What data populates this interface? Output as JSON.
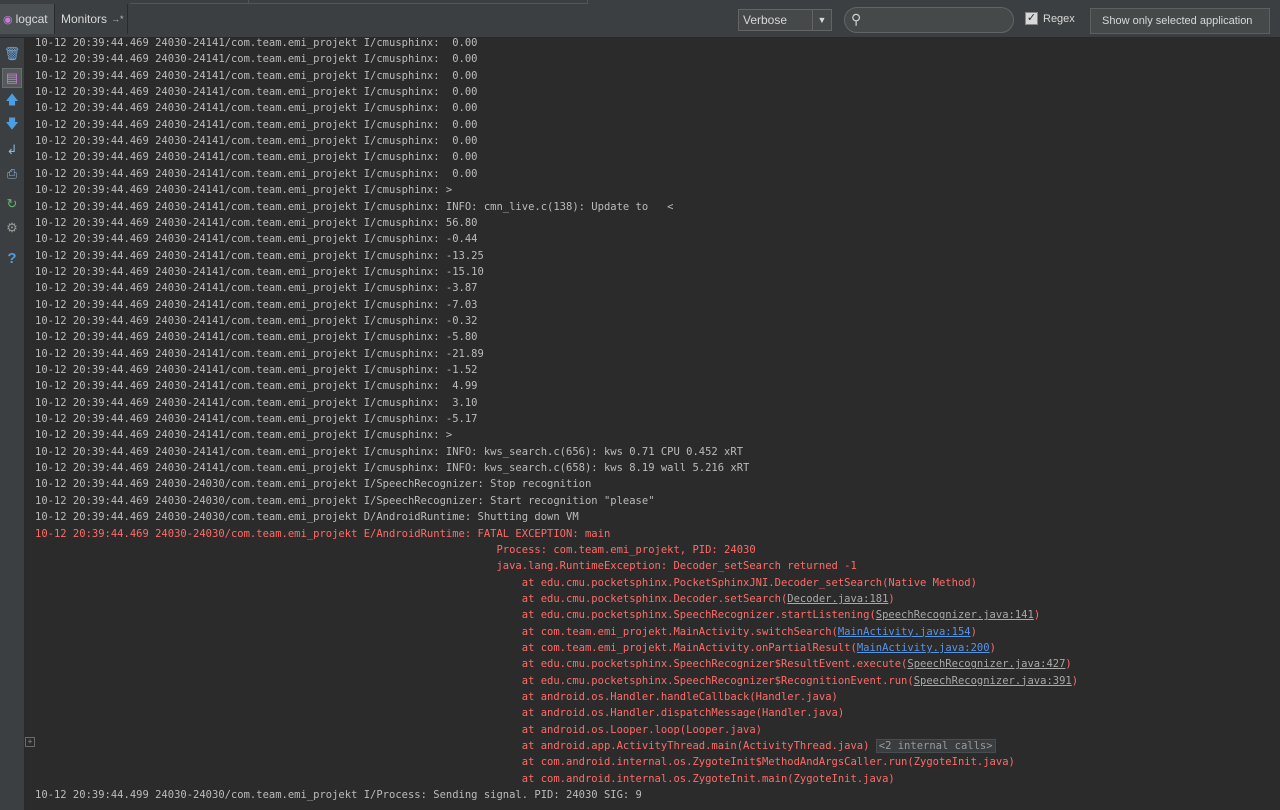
{
  "toolbar": {
    "tab_logcat": "logcat",
    "tab_monitors": "Monitors",
    "monitors_arrow": "→*",
    "log_level": "Verbose",
    "search_value": "",
    "regex_label": "Regex",
    "regex_checked": true,
    "filter_option": "Show only selected application"
  },
  "sidebar": {
    "icons": [
      "trash-icon",
      "scroll-to-end-icon",
      "up-arrow-icon",
      "down-arrow-icon",
      "soft-wrap-icon",
      "print-icon",
      "restart-icon",
      "settings-icon",
      "help-icon"
    ]
  },
  "colors": {
    "info": "#bbbbbb",
    "error": "#ff6b68",
    "link": "#5894e6",
    "background": "#2b2b2b"
  },
  "log": {
    "lines": [
      {
        "text": "10-12 20:39:44.469 24030-24141/com.team.emi_projekt I/cmusphinx:  0.00",
        "err": false
      },
      {
        "text": "10-12 20:39:44.469 24030-24141/com.team.emi_projekt I/cmusphinx:  0.00",
        "err": false
      },
      {
        "text": "10-12 20:39:44.469 24030-24141/com.team.emi_projekt I/cmusphinx:  0.00",
        "err": false
      },
      {
        "text": "10-12 20:39:44.469 24030-24141/com.team.emi_projekt I/cmusphinx:  0.00",
        "err": false
      },
      {
        "text": "10-12 20:39:44.469 24030-24141/com.team.emi_projekt I/cmusphinx:  0.00",
        "err": false
      },
      {
        "text": "10-12 20:39:44.469 24030-24141/com.team.emi_projekt I/cmusphinx:  0.00",
        "err": false
      },
      {
        "text": "10-12 20:39:44.469 24030-24141/com.team.emi_projekt I/cmusphinx:  0.00",
        "err": false
      },
      {
        "text": "10-12 20:39:44.469 24030-24141/com.team.emi_projekt I/cmusphinx:  0.00",
        "err": false
      },
      {
        "text": "10-12 20:39:44.469 24030-24141/com.team.emi_projekt I/cmusphinx:  0.00",
        "err": false
      },
      {
        "text": "10-12 20:39:44.469 24030-24141/com.team.emi_projekt I/cmusphinx: >",
        "err": false
      },
      {
        "text": "10-12 20:39:44.469 24030-24141/com.team.emi_projekt I/cmusphinx: INFO: cmn_live.c(138): Update to   <",
        "err": false
      },
      {
        "text": "10-12 20:39:44.469 24030-24141/com.team.emi_projekt I/cmusphinx: 56.80",
        "err": false
      },
      {
        "text": "10-12 20:39:44.469 24030-24141/com.team.emi_projekt I/cmusphinx: -0.44",
        "err": false
      },
      {
        "text": "10-12 20:39:44.469 24030-24141/com.team.emi_projekt I/cmusphinx: -13.25",
        "err": false
      },
      {
        "text": "10-12 20:39:44.469 24030-24141/com.team.emi_projekt I/cmusphinx: -15.10",
        "err": false
      },
      {
        "text": "10-12 20:39:44.469 24030-24141/com.team.emi_projekt I/cmusphinx: -3.87",
        "err": false
      },
      {
        "text": "10-12 20:39:44.469 24030-24141/com.team.emi_projekt I/cmusphinx: -7.03",
        "err": false
      },
      {
        "text": "10-12 20:39:44.469 24030-24141/com.team.emi_projekt I/cmusphinx: -0.32",
        "err": false
      },
      {
        "text": "10-12 20:39:44.469 24030-24141/com.team.emi_projekt I/cmusphinx: -5.80",
        "err": false
      },
      {
        "text": "10-12 20:39:44.469 24030-24141/com.team.emi_projekt I/cmusphinx: -21.89",
        "err": false
      },
      {
        "text": "10-12 20:39:44.469 24030-24141/com.team.emi_projekt I/cmusphinx: -1.52",
        "err": false
      },
      {
        "text": "10-12 20:39:44.469 24030-24141/com.team.emi_projekt I/cmusphinx:  4.99",
        "err": false
      },
      {
        "text": "10-12 20:39:44.469 24030-24141/com.team.emi_projekt I/cmusphinx:  3.10",
        "err": false
      },
      {
        "text": "10-12 20:39:44.469 24030-24141/com.team.emi_projekt I/cmusphinx: -5.17",
        "err": false
      },
      {
        "text": "10-12 20:39:44.469 24030-24141/com.team.emi_projekt I/cmusphinx: >",
        "err": false
      },
      {
        "text": "10-12 20:39:44.469 24030-24141/com.team.emi_projekt I/cmusphinx: INFO: kws_search.c(656): kws 0.71 CPU 0.452 xRT",
        "err": false
      },
      {
        "text": "10-12 20:39:44.469 24030-24141/com.team.emi_projekt I/cmusphinx: INFO: kws_search.c(658): kws 8.19 wall 5.216 xRT",
        "err": false
      },
      {
        "text": "10-12 20:39:44.469 24030-24030/com.team.emi_projekt I/SpeechRecognizer: Stop recognition",
        "err": false
      },
      {
        "text": "10-12 20:39:44.469 24030-24030/com.team.emi_projekt I/SpeechRecognizer: Start recognition \"please\"",
        "err": false
      },
      {
        "text": "10-12 20:39:44.469 24030-24030/com.team.emi_projekt D/AndroidRuntime: Shutting down VM",
        "err": false
      },
      {
        "text": "10-12 20:39:44.469 24030-24030/com.team.emi_projekt E/AndroidRuntime: FATAL EXCEPTION: main",
        "err": true
      },
      {
        "text": "                                                                         Process: com.team.emi_projekt, PID: 24030",
        "err": true
      },
      {
        "text": "                                                                         java.lang.RuntimeException: Decoder_setSearch returned -1",
        "err": true
      },
      {
        "text": "                                                                             at edu.cmu.pocketsphinx.PocketSphinxJNI.Decoder_setSearch(Native Method)",
        "err": true
      },
      {
        "text": "                                                                             at edu.cmu.pocketsphinx.Decoder.setSearch(",
        "err": true,
        "link": "Decoder.java:181",
        "link_style": "grey",
        "tail": ")"
      },
      {
        "text": "                                                                             at edu.cmu.pocketsphinx.SpeechRecognizer.startListening(",
        "err": true,
        "link": "SpeechRecognizer.java:141",
        "link_style": "grey",
        "tail": ")"
      },
      {
        "text": "                                                                             at com.team.emi_projekt.MainActivity.switchSearch(",
        "err": true,
        "link": "MainActivity.java:154",
        "link_style": "blue",
        "tail": ")"
      },
      {
        "text": "                                                                             at com.team.emi_projekt.MainActivity.onPartialResult(",
        "err": true,
        "link": "MainActivity.java:200",
        "link_style": "blue",
        "tail": ")"
      },
      {
        "text": "                                                                             at edu.cmu.pocketsphinx.SpeechRecognizer$ResultEvent.execute(",
        "err": true,
        "link": "SpeechRecognizer.java:427",
        "link_style": "grey",
        "tail": ")"
      },
      {
        "text": "                                                                             at edu.cmu.pocketsphinx.SpeechRecognizer$RecognitionEvent.run(",
        "err": true,
        "link": "SpeechRecognizer.java:391",
        "link_style": "grey",
        "tail": ")"
      },
      {
        "text": "                                                                             at android.os.Handler.handleCallback(Handler.java)",
        "err": true
      },
      {
        "text": "                                                                             at android.os.Handler.dispatchMessage(Handler.java)",
        "err": true
      },
      {
        "text": "                                                                             at android.os.Looper.loop(Looper.java)",
        "err": true
      },
      {
        "text": "                                                                             at android.app.ActivityThread.main(ActivityThread.java) ",
        "err": true,
        "chip": "<2 internal calls>"
      },
      {
        "text": "                                                                             at com.android.internal.os.ZygoteInit$MethodAndArgsCaller.run(ZygoteInit.java)",
        "err": true
      },
      {
        "text": "                                                                             at com.android.internal.os.ZygoteInit.main(ZygoteInit.java)",
        "err": true
      },
      {
        "text": "10-12 20:39:44.499 24030-24030/com.team.emi_projekt I/Process: Sending signal. PID: 24030 SIG: 9",
        "err": false
      }
    ]
  }
}
